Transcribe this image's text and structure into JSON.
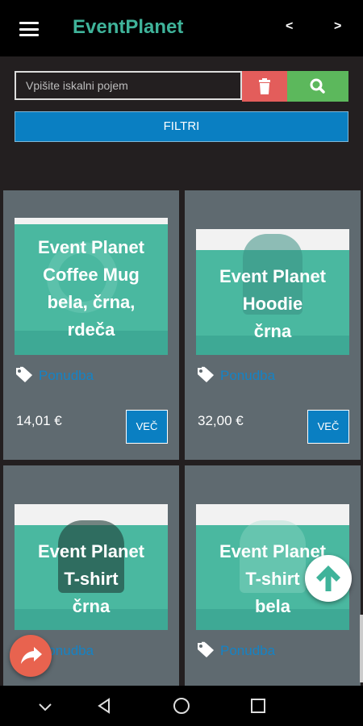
{
  "header": {
    "title": "EventPlanet",
    "prev_label": "<",
    "next_label": ">"
  },
  "search": {
    "placeholder": "Vpišite iskalni pojem",
    "filter_label": "FILTRI"
  },
  "products": [
    {
      "title_lines": [
        "Event Planet",
        "Coffee Mug",
        "bela, črna,",
        "rdeča"
      ],
      "tag": "Ponudba",
      "price": "14,01 €",
      "more_label": "VEČ"
    },
    {
      "title_lines": [
        "Event Planet",
        "Hoodie",
        "črna"
      ],
      "tag": "Ponudba",
      "price": "32,00 €",
      "more_label": "VEČ"
    },
    {
      "title_lines": [
        "Event Planet",
        "T-shirt",
        "črna"
      ],
      "tag": "Ponudba"
    },
    {
      "title_lines": [
        "Event Planet",
        "T-shirt",
        "bela"
      ],
      "tag": "Ponudba"
    }
  ],
  "colors": {
    "accent": "#3fb39a",
    "primary": "#0a7fc2",
    "danger": "#e35d5b",
    "success": "#5cb85c",
    "card_bg": "#5f6a70"
  },
  "icons": [
    "menu-icon",
    "trash-icon",
    "search-icon",
    "tag-icon",
    "arrow-up-icon",
    "share-icon",
    "nav-back-icon",
    "nav-home-icon",
    "nav-recents-icon",
    "nav-down-icon"
  ]
}
